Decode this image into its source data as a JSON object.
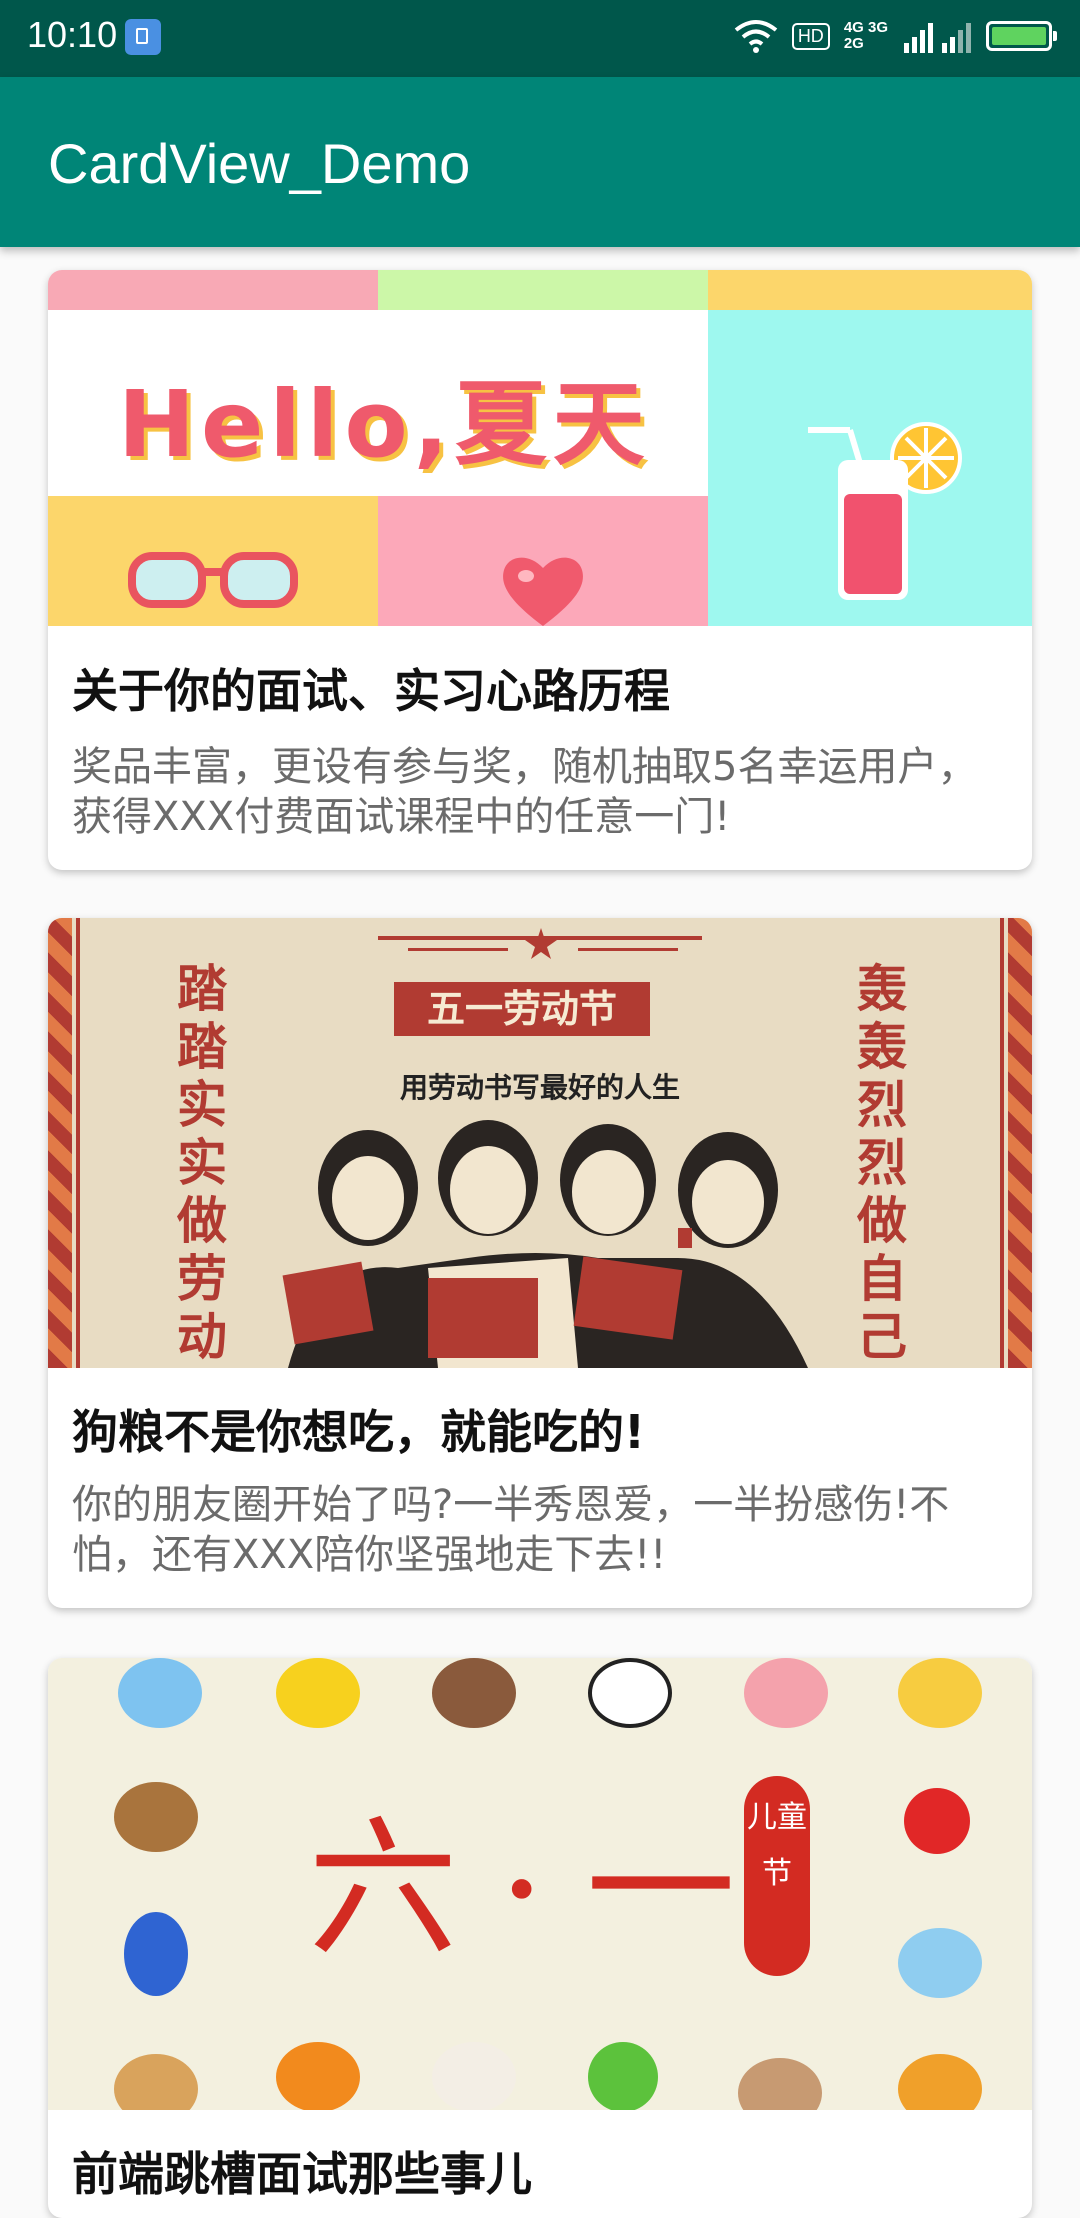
{
  "status_bar": {
    "time": "10:10",
    "hd_label": "HD",
    "net_label_top": "4G 3G",
    "net_label_bottom": "2G",
    "icons": [
      "notification-icon",
      "wifi-icon",
      "hd-icon",
      "signal-icon",
      "battery-icon"
    ]
  },
  "app_bar": {
    "title": "CardView_Demo",
    "color": "#008577"
  },
  "cards": [
    {
      "image": {
        "text": "Hello,夏天"
      },
      "title": "关于你的面试、实习心路历程",
      "desc": "奖品丰富，更设有参与奖，随机抽取5名幸运用户，获得XXX付费面试课程中的任意一门!"
    },
    {
      "image": {
        "left_vertical": "踏踏实实做劳动",
        "right_vertical": "轰轰烈烈做自己",
        "banner_title": "五一劳动节",
        "banner_subtitle": "用劳动书写最好的人生"
      },
      "title": "狗粮不是你想吃，就能吃的!",
      "desc": "你的朋友圈开始了吗?一半秀恩爱，一半扮感伤!不怕，还有XXX陪你坚强地走下去!!"
    },
    {
      "image": {
        "main_text": "六·一",
        "tag_text": "儿童节"
      },
      "title": "前端跳槽面试那些事儿"
    }
  ]
}
